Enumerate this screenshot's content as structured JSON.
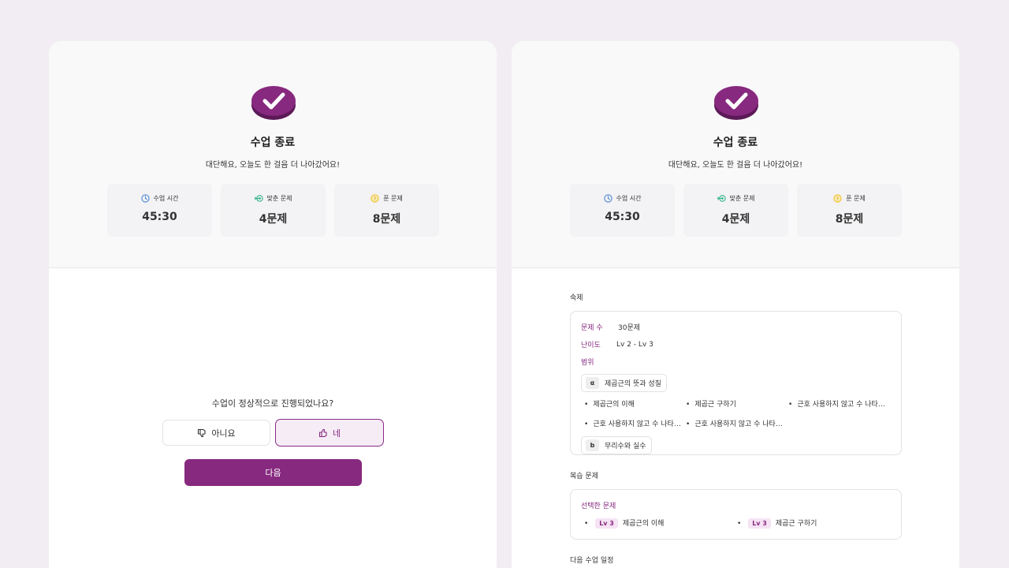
{
  "summary": {
    "title": "수업 종료",
    "subtitle": "대단해요, 오늘도 한 걸음 더 나아갔어요!",
    "stats": [
      {
        "label": "수업 시간",
        "value": "45:30",
        "icon": "clock-icon"
      },
      {
        "label": "맞춘 문제",
        "value": "4문제",
        "icon": "target-icon"
      },
      {
        "label": "푼 문제",
        "value": "8문제",
        "icon": "question-icon"
      }
    ]
  },
  "feedback": {
    "question": "수업이 정상적으로 진행되었나요?",
    "no_label": "아니요",
    "yes_label": "네",
    "next_label": "다음"
  },
  "homework": {
    "title": "숙제",
    "count_label": "문제 수",
    "count_value": "30문제",
    "level_label": "난이도",
    "level_value": "Lv 2 - Lv 3",
    "range_label": "범위",
    "chapters": [
      {
        "badge": "α",
        "name": "제곱근의 뜻과 성질",
        "topics": [
          "제곱근의 이해",
          "제곱근 구하기",
          "근호 사용하지 않고 수 나타…",
          "근호 사용하지 않고 수 나타…",
          "근호 사용하지 않고 수 나타…"
        ]
      },
      {
        "badge": "b",
        "name": "무리수와 실수",
        "topics": []
      }
    ]
  },
  "review": {
    "title": "복습 문제",
    "selected_label": "선택한 문제",
    "items": [
      {
        "level": "Lv 3",
        "name": "제곱근의 이해"
      },
      {
        "level": "Lv 3",
        "name": "제곱근 구하기"
      }
    ]
  },
  "next_schedule": {
    "title": "다음 수업 일정"
  },
  "colors": {
    "brand": "#87297f",
    "brand_light": "#f6ecf6",
    "background": "#f2edf3",
    "clock": "#4a86d8",
    "target": "#2fb58a",
    "question": "#f2c230"
  }
}
